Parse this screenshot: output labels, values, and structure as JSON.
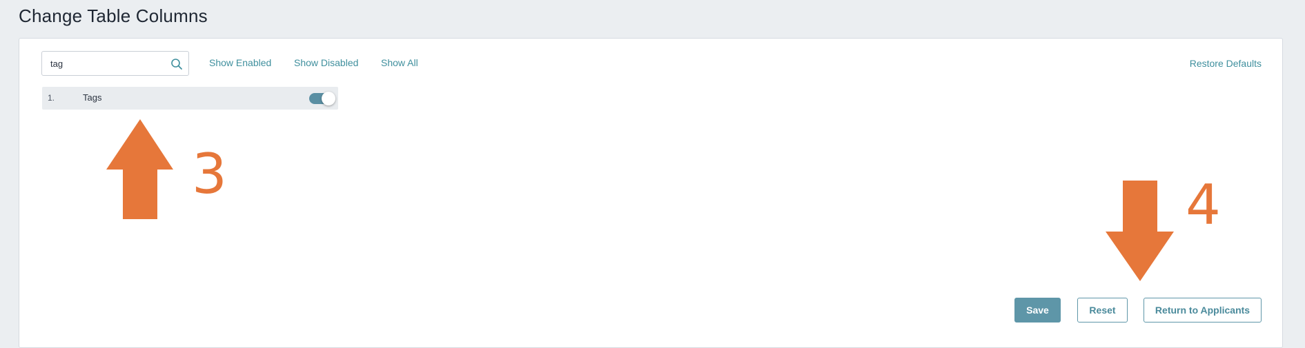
{
  "page": {
    "title": "Change Table Columns"
  },
  "search": {
    "value": "tag",
    "placeholder": ""
  },
  "filters": {
    "show_enabled": "Show Enabled",
    "show_disabled": "Show Disabled",
    "show_all": "Show All",
    "restore_defaults": "Restore Defaults"
  },
  "columns": [
    {
      "index": "1.",
      "label": "Tags",
      "enabled": true
    }
  ],
  "actions": {
    "save": "Save",
    "reset": "Reset",
    "return": "Return to Applicants"
  },
  "annotations": {
    "step_up": "3",
    "step_down": "4",
    "color": "#e6773a"
  },
  "colors": {
    "accent": "#3f8f9d",
    "primary_button": "#5e96a8",
    "toggle_on": "#5a8fa3"
  },
  "icons": {
    "search": "search-icon"
  }
}
